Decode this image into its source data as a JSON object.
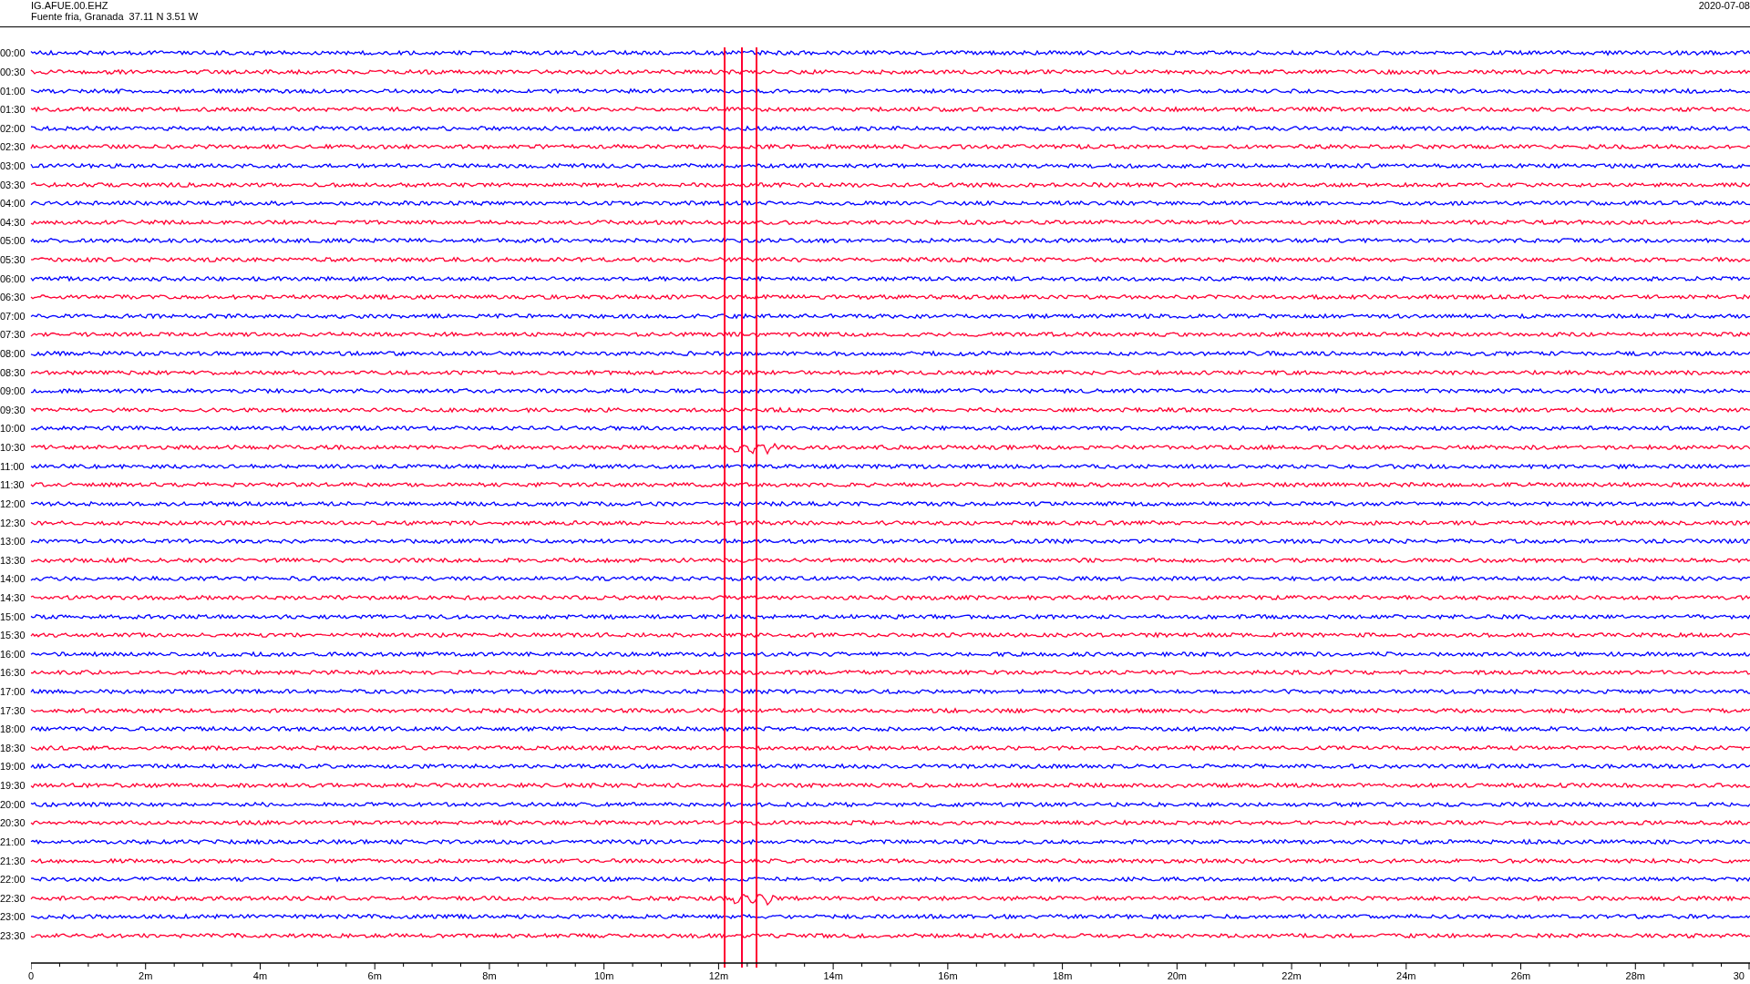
{
  "header": {
    "station": "IG.AFUE.00.EHZ",
    "location": "Fuente fria, Granada  37.11 N 3.51 W",
    "date": "2020-07-08"
  },
  "rows": [
    {
      "label": "00:00",
      "color": "#0000ff"
    },
    {
      "label": "00:30",
      "color": "#ff0033"
    },
    {
      "label": "01:00",
      "color": "#0000ff"
    },
    {
      "label": "01:30",
      "color": "#ff0033"
    },
    {
      "label": "02:00",
      "color": "#0000ff"
    },
    {
      "label": "02:30",
      "color": "#ff0033"
    },
    {
      "label": "03:00",
      "color": "#0000ff"
    },
    {
      "label": "03:30",
      "color": "#ff0033"
    },
    {
      "label": "04:00",
      "color": "#0000ff"
    },
    {
      "label": "04:30",
      "color": "#ff0033"
    },
    {
      "label": "05:00",
      "color": "#0000ff"
    },
    {
      "label": "05:30",
      "color": "#ff0033"
    },
    {
      "label": "06:00",
      "color": "#0000ff"
    },
    {
      "label": "06:30",
      "color": "#ff0033"
    },
    {
      "label": "07:00",
      "color": "#0000ff"
    },
    {
      "label": "07:30",
      "color": "#ff0033"
    },
    {
      "label": "08:00",
      "color": "#0000ff"
    },
    {
      "label": "08:30",
      "color": "#ff0033"
    },
    {
      "label": "09:00",
      "color": "#0000ff"
    },
    {
      "label": "09:30",
      "color": "#ff0033"
    },
    {
      "label": "10:00",
      "color": "#0000ff"
    },
    {
      "label": "10:30",
      "color": "#ff0033"
    },
    {
      "label": "11:00",
      "color": "#0000ff"
    },
    {
      "label": "11:30",
      "color": "#ff0033"
    },
    {
      "label": "12:00",
      "color": "#0000ff"
    },
    {
      "label": "12:30",
      "color": "#ff0033"
    },
    {
      "label": "13:00",
      "color": "#0000ff"
    },
    {
      "label": "13:30",
      "color": "#ff0033"
    },
    {
      "label": "14:00",
      "color": "#0000ff"
    },
    {
      "label": "14:30",
      "color": "#ff0033"
    },
    {
      "label": "15:00",
      "color": "#0000ff"
    },
    {
      "label": "15:30",
      "color": "#ff0033"
    },
    {
      "label": "16:00",
      "color": "#0000ff"
    },
    {
      "label": "16:30",
      "color": "#ff0033"
    },
    {
      "label": "17:00",
      "color": "#0000ff"
    },
    {
      "label": "17:30",
      "color": "#ff0033"
    },
    {
      "label": "18:00",
      "color": "#0000ff"
    },
    {
      "label": "18:30",
      "color": "#ff0033"
    },
    {
      "label": "19:00",
      "color": "#0000ff"
    },
    {
      "label": "19:30",
      "color": "#ff0033"
    },
    {
      "label": "20:00",
      "color": "#0000ff"
    },
    {
      "label": "20:30",
      "color": "#ff0033"
    },
    {
      "label": "21:00",
      "color": "#0000ff"
    },
    {
      "label": "21:30",
      "color": "#ff0033"
    },
    {
      "label": "22:00",
      "color": "#0000ff"
    },
    {
      "label": "22:30",
      "color": "#ff0033"
    },
    {
      "label": "23:00",
      "color": "#0000ff"
    },
    {
      "label": "23:30",
      "color": "#ff0033"
    }
  ],
  "axis": {
    "labels": [
      "0",
      "2m",
      "4m",
      "6m",
      "8m",
      "10m",
      "12m",
      "14m",
      "16m",
      "18m",
      "20m",
      "22m",
      "24m",
      "26m",
      "28m",
      "30"
    ]
  }
}
